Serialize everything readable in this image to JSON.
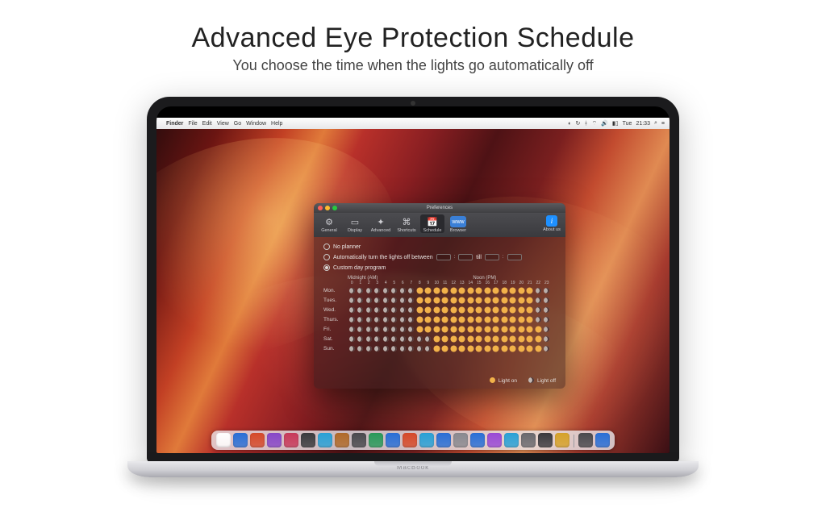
{
  "headline": {
    "title": "Advanced Eye Protection Schedule",
    "subtitle": "You choose the time when the lights go automatically off"
  },
  "laptop_brand": "MacBook",
  "menubar": {
    "apple": "",
    "app": "Finder",
    "items": [
      "File",
      "Edit",
      "View",
      "Go",
      "Window",
      "Help"
    ],
    "status_day": "Tue",
    "status_time": "21:33"
  },
  "dock_colors": [
    "#ffffff",
    "#2a6fd6",
    "#d64a2a",
    "#8848c8",
    "#c83a5a",
    "#3a3a3e",
    "#2aa1d6",
    "#b06a2a",
    "#4a4a4e",
    "#2a9a5a",
    "#2a6fd6",
    "#d64a2a",
    "#2aa1d6",
    "#2a6fd6",
    "#8a8a90",
    "#2a6fd6",
    "#9a4ad6",
    "#2aa1d6",
    "#6a6a6e",
    "#3a3a3e",
    "#d6a22a",
    "#4a4a4e",
    "#2a6fd6"
  ],
  "prefs": {
    "window_title": "Preferences",
    "toolbar": {
      "items": [
        {
          "label": "General",
          "icon": "⚙"
        },
        {
          "label": "Display",
          "icon": "▭"
        },
        {
          "label": "Advanced",
          "icon": "✦"
        },
        {
          "label": "Shortcuts",
          "icon": "⌘"
        },
        {
          "label": "Schedule",
          "icon": "📅",
          "selected": true
        },
        {
          "label": "Browser",
          "icon": "www"
        }
      ],
      "about_label": "About us",
      "about_icon": "i"
    },
    "options": {
      "no_planner": "No planner",
      "auto_between": "Automatically turn the lights off between",
      "till": "till",
      "custom": "Custom day program",
      "selected": "custom"
    },
    "schedule": {
      "header_am": "Midnight (AM)",
      "header_pm": "Noon (PM)",
      "hours": [
        "0",
        "1",
        "2",
        "3",
        "4",
        "5",
        "6",
        "7",
        "8",
        "9",
        "10",
        "11",
        "12",
        "13",
        "14",
        "15",
        "16",
        "17",
        "18",
        "19",
        "20",
        "21",
        "22",
        "23"
      ],
      "days": [
        "Mon.",
        "Tues.",
        "Wed.",
        "Thurs.",
        "Fri.",
        "Sat.",
        "Sun."
      ],
      "pattern_weekday": "mmmmmmmmssssssssssssssmm",
      "pattern_friday": "mmmmmmmmsssssssssssssssm",
      "pattern_weekend": "mmmmmmmmmmsssssssssssssm"
    },
    "legend": {
      "on": "Light on",
      "off": "Light off"
    }
  }
}
